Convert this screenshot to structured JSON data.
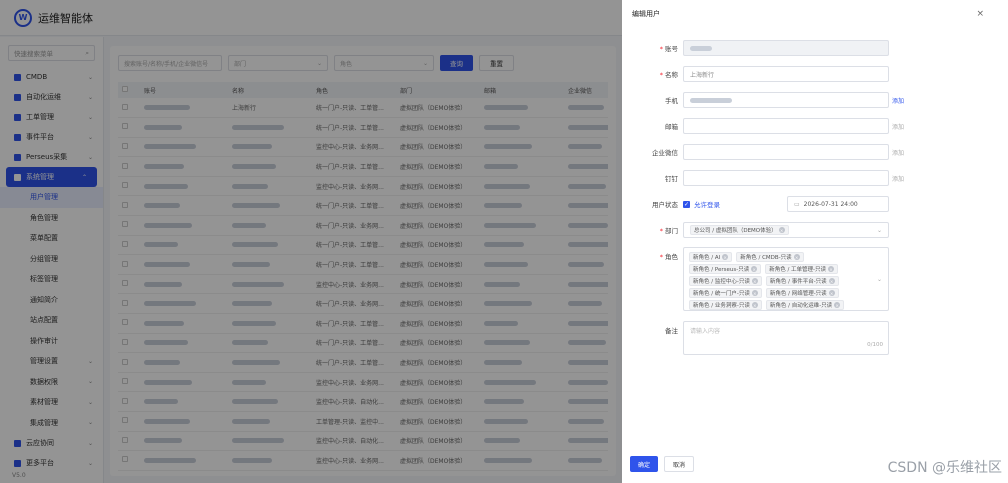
{
  "app": {
    "title": "运维智能体",
    "logo_letter": "W",
    "sidebar": {
      "search_placeholder": "快速搜索菜单",
      "items": [
        {
          "label": "CMDB",
          "icon": "cube-icon"
        },
        {
          "label": "自动化运维",
          "icon": "gear-icon"
        },
        {
          "label": "工单管理",
          "icon": "ticket-icon"
        },
        {
          "label": "事件平台",
          "icon": "bell-icon"
        },
        {
          "label": "Perseus采集",
          "icon": "diamond-icon"
        }
      ],
      "system_label": "系统管理",
      "subs": [
        "用户管理",
        "角色管理",
        "菜单配置",
        "分组管理",
        "标签管理",
        "通知简介",
        "站点配置",
        "操作审计",
        "管理设置",
        "数据权限",
        "素材管理",
        "集成管理"
      ],
      "bottom_items": [
        "云应协同",
        "更多平台"
      ],
      "footer": "V5.0"
    },
    "filters": {
      "keyword_placeholder": "搜索账号/名称/手机/企业微信号",
      "dept_placeholder": "部门",
      "role_placeholder": "角色",
      "search_label": "查询",
      "reset_label": "重置"
    },
    "table": {
      "headers": [
        "",
        "账号",
        "名称",
        "角色",
        "部门",
        "邮箱",
        "企业微信"
      ],
      "rows": [
        [
          "",
          "",
          "上海新行",
          "统一门户-只读、工单管...",
          "虚拟团队（DEMO体验）",
          "",
          ""
        ],
        [
          "",
          "",
          "",
          "统一门户-只读、工单管...",
          "虚拟团队（DEMO体验）",
          "",
          ""
        ],
        [
          "",
          "",
          "",
          "监控中心-只读、业务网...",
          "虚拟团队（DEMO体验）",
          "",
          ""
        ],
        [
          "",
          "",
          "",
          "统一门户-只读、工单管...",
          "虚拟团队（DEMO体验）",
          "",
          ""
        ],
        [
          "",
          "",
          "",
          "监控中心-只读、业务网...",
          "虚拟团队（DEMO体验）",
          "",
          ""
        ],
        [
          "",
          "",
          "",
          "统一门户-只读、工单管...",
          "虚拟团队（DEMO体验）",
          "",
          ""
        ],
        [
          "",
          "",
          "",
          "统一门户-只读、业务网...",
          "虚拟团队（DEMO体验）",
          "",
          ""
        ],
        [
          "",
          "",
          "",
          "统一门户-只读、工单管...",
          "虚拟团队（DEMO体验）",
          "",
          ""
        ],
        [
          "",
          "",
          "",
          "统一门户-只读、工单管...",
          "虚拟团队（DEMO体验）",
          "",
          ""
        ],
        [
          "",
          "",
          "",
          "监控中心-只读、业务网...",
          "虚拟团队（DEMO体验）",
          "",
          ""
        ],
        [
          "",
          "",
          "",
          "统一门户-只读、业务网...",
          "虚拟团队（DEMO体验）",
          "",
          ""
        ],
        [
          "",
          "",
          "",
          "统一门户-只读、工单管...",
          "虚拟团队（DEMO体验）",
          "",
          ""
        ],
        [
          "",
          "",
          "",
          "统一门户-只读、工单管...",
          "虚拟团队（DEMO体验）",
          "",
          ""
        ],
        [
          "",
          "",
          "",
          "统一门户-只读、工单管...",
          "虚拟团队（DEMO体验）",
          "",
          ""
        ],
        [
          "",
          "",
          "",
          "监控中心-只读、业务网...",
          "虚拟团队（DEMO体验）",
          "",
          ""
        ],
        [
          "",
          "",
          "",
          "监控中心-只读、自动化...",
          "虚拟团队（DEMO体验）",
          "",
          ""
        ],
        [
          "",
          "",
          "",
          "工单管理-只读、监控中...",
          "虚拟团队（DEMO体验）",
          "",
          ""
        ],
        [
          "",
          "",
          "",
          "监控中心-只读、自动化...",
          "虚拟团队（DEMO体验）",
          "",
          ""
        ],
        [
          "",
          "",
          "",
          "监控中心-只读、业务网...",
          "虚拟团队（DEMO体验）",
          "",
          ""
        ]
      ]
    }
  },
  "drawer": {
    "title": "编辑用户",
    "close_glyph": "×",
    "fields": {
      "account_label": "账号",
      "account_value": "",
      "name_label": "名称",
      "name_value": "上海新行",
      "phone_label": "手机",
      "phone_value": "",
      "phone_action": "添加",
      "email_label": "邮箱",
      "email_action": "添加",
      "wechat_label": "企业微信",
      "wechat_action": "添加",
      "dingtalk_label": "钉钉",
      "dingtalk_action": "添加",
      "status_label": "用户状态",
      "status_checkbox_label": "允许登录",
      "expiry_value": "2026-07-31 24:00",
      "dept_label": "部门",
      "dept_value": "总公司 / 虚拟团队（DEMO体验）",
      "role_label": "角色",
      "roles": [
        "新角色 / AI",
        "新角色 / CMDB-只读",
        "新角色 / Perseus-只读",
        "新角色 / 工单管理-只读",
        "新角色 / 监控中心-只读",
        "新角色 / 事件平台-只读",
        "新角色 / 统一门户-只读",
        "新角色 / 网络管理-只读",
        "新角色 / 业务洞察-只读",
        "新角色 / 自动化运维-只读"
      ],
      "remark_label": "备注",
      "remark_placeholder": "请输入内容",
      "remark_counter": "0/100"
    },
    "confirm_label": "确定",
    "cancel_label": "取消"
  },
  "watermark": "CSDN @乐维社区"
}
